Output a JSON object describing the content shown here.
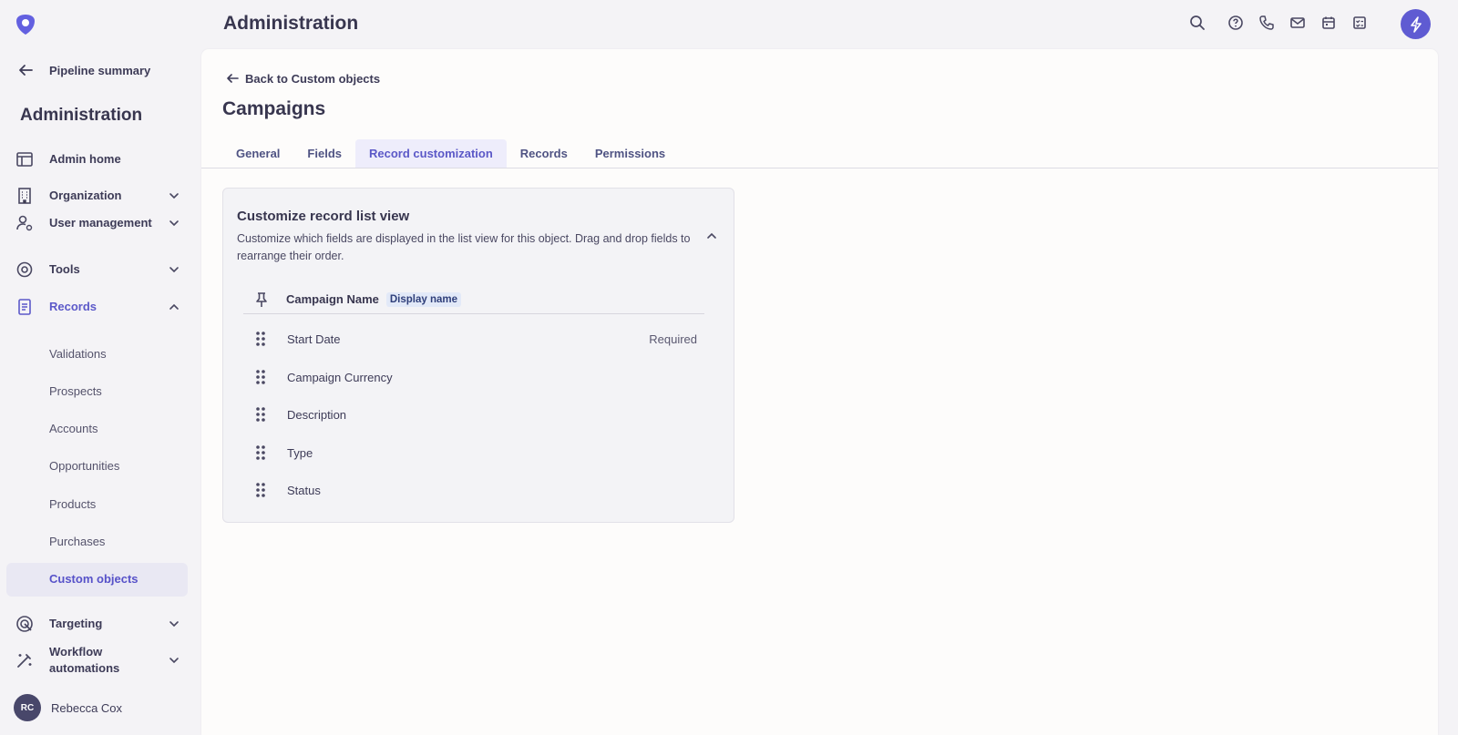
{
  "header": {
    "title": "Administration"
  },
  "sidebar": {
    "back_label": "Pipeline summary",
    "title": "Administration",
    "items": [
      {
        "label": "Admin home"
      },
      {
        "label": "Organization"
      },
      {
        "label": "User management"
      },
      {
        "label": "Tools"
      },
      {
        "label": "Records"
      },
      {
        "label": "Targeting"
      },
      {
        "label": "Workflow automations"
      }
    ],
    "records_sub": [
      "Validations",
      "Prospects",
      "Accounts",
      "Opportunities",
      "Products",
      "Purchases",
      "Custom objects"
    ],
    "user": {
      "initials": "RC",
      "name": "Rebecca Cox"
    }
  },
  "main": {
    "back_label": "Back to Custom objects",
    "title": "Campaigns",
    "tabs": [
      "General",
      "Fields",
      "Record customization",
      "Records",
      "Permissions"
    ],
    "active_tab": "Record customization"
  },
  "card": {
    "title": "Customize record list view",
    "description": "Customize which fields are displayed in the list view for this object. Drag and drop fields to rearrange their order.",
    "pinned_field": "Campaign Name",
    "pinned_badge": "Display name",
    "fields": [
      {
        "name": "Start Date",
        "tag": "Required"
      },
      {
        "name": "Campaign Currency",
        "tag": ""
      },
      {
        "name": "Description",
        "tag": ""
      },
      {
        "name": "Type",
        "tag": ""
      },
      {
        "name": "Status",
        "tag": ""
      }
    ]
  },
  "colors": {
    "accent": "#5f5bd2",
    "active_text": "#5b58c7",
    "badge_bg": "#e2e9f8"
  }
}
